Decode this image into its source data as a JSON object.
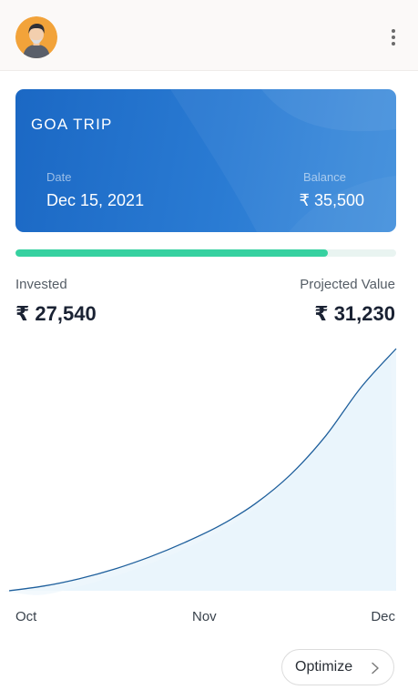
{
  "header": {
    "avatar_icon": "user-avatar-icon",
    "menu_icon": "more-vertical-icon"
  },
  "card": {
    "title": "GOA TRIP",
    "date_label": "Date",
    "date_value": "Dec 15, 2021",
    "balance_label": "Balance",
    "balance_value": "₹ 35,500",
    "colors": {
      "gradient_start": "#1b68c4",
      "gradient_end": "#3f8edc"
    }
  },
  "progress": {
    "fraction": 0.82,
    "color": "#36d1a0",
    "track_color": "#e9f4f1"
  },
  "stats": {
    "invested_label": "Invested",
    "invested_value": "₹ 27,540",
    "projected_label": "Projected Value",
    "projected_value": "₹ 31,230"
  },
  "chart_data": {
    "type": "area",
    "title": "",
    "xlabel": "",
    "ylabel": "",
    "categories": [
      "Oct",
      "Nov",
      "Dec"
    ],
    "grid": false,
    "series": [
      {
        "line_color": "#1e5f9c",
        "fill_color": "#e3f1fb",
        "values": [
          0.0,
          0.02,
          0.05,
          0.09,
          0.14,
          0.2,
          0.27,
          0.36,
          0.48,
          0.64,
          0.84,
          1.0
        ]
      }
    ]
  },
  "actions": {
    "optimize_label": "Optimize",
    "optimize_icon": "chevron-right-icon"
  }
}
